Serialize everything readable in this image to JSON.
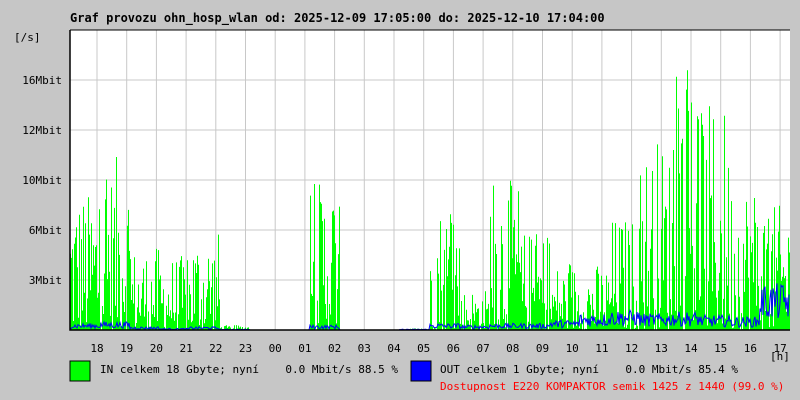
{
  "chart_data": {
    "type": "area",
    "title": "Graf provozu ohn_hosp_wlan od: 2025-12-09 17:05:00 do: 2025-12-10 17:04:00",
    "ylabel": "[/s]",
    "xlabel": "[h]",
    "y_ticks": [
      "16Mbit",
      "12Mbit",
      "10Mbit",
      "6Mbit",
      "3Mbit"
    ],
    "y_tick_values": [
      16,
      12,
      10,
      6,
      3
    ],
    "x_ticks": [
      "18",
      "19",
      "20",
      "21",
      "22",
      "23",
      "00",
      "01",
      "02",
      "03",
      "04",
      "05",
      "06",
      "07",
      "08",
      "09",
      "10",
      "11",
      "12",
      "13",
      "14",
      "15",
      "16",
      "17"
    ],
    "grid": true,
    "series": [
      {
        "name": "IN",
        "color": "#00ff00",
        "unit": "Mbit/s",
        "hourly_peak": [
          9,
          11,
          5,
          4.5,
          6,
          0.3,
          0,
          0,
          10,
          0,
          0,
          0.1,
          8,
          2.5,
          10,
          6,
          4,
          4,
          7,
          12,
          17,
          14,
          10,
          8
        ]
      },
      {
        "name": "OUT",
        "color": "#0000ff",
        "unit": "Mbit/s",
        "hourly_peak": [
          0.4,
          0.5,
          0.2,
          0.1,
          0.2,
          0.05,
          0,
          0,
          0.3,
          0,
          0,
          0.05,
          0.4,
          0.3,
          0.4,
          0.4,
          0.6,
          1,
          1.2,
          1,
          1.1,
          0.9,
          0.8,
          2.8
        ]
      }
    ]
  },
  "legend": {
    "in_label": "IN celkem 18 Gbyte; nyní    0.0 Mbit/s 88.5 %",
    "out_label": "OUT celkem 1 Gbyte; nyní    0.0 Mbit/s 85.4 %",
    "availability": "Dostupnost E220 KOMPAKTOR semik 1425 z 1440 (99.0 %)",
    "availability_color": "#ff0000"
  }
}
